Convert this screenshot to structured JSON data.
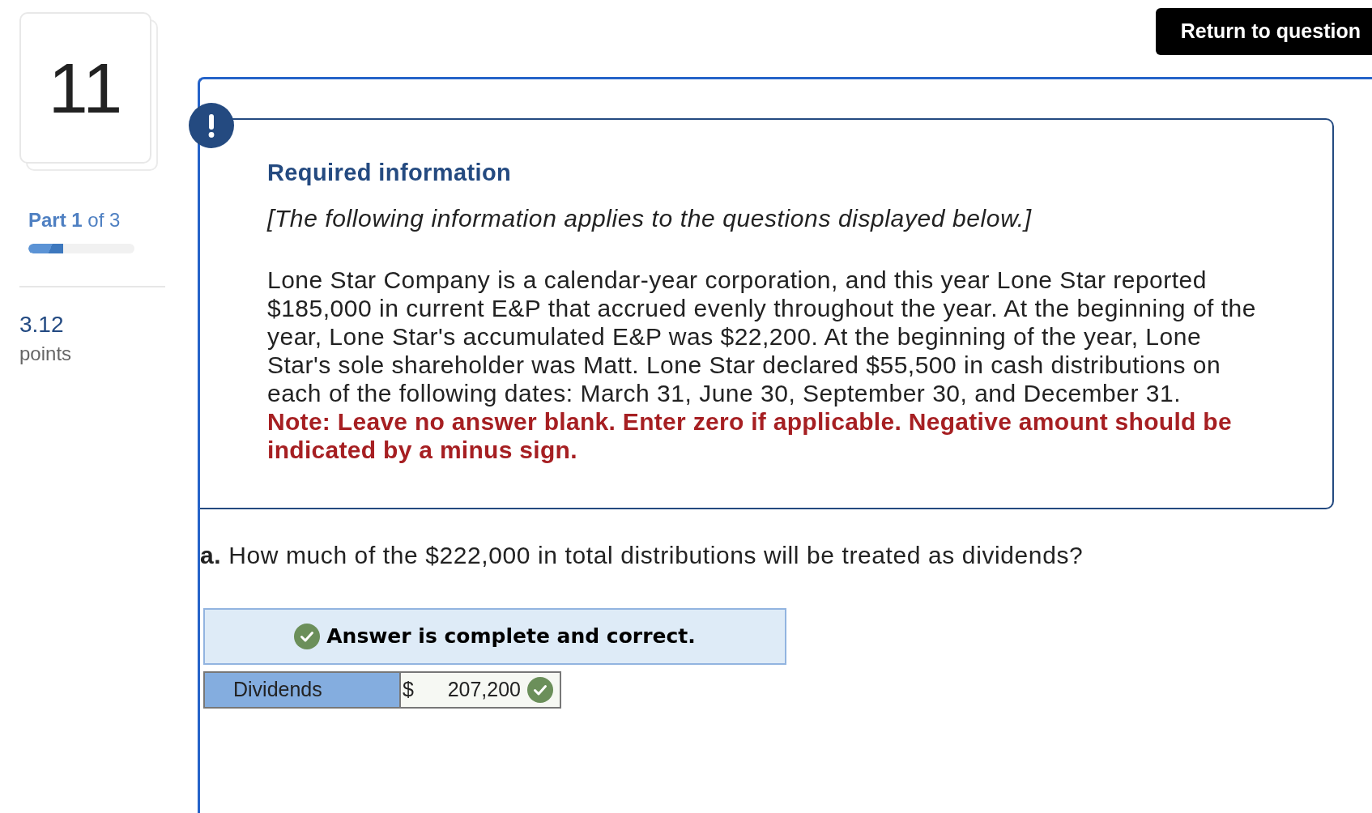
{
  "sidebar": {
    "question_number": "11",
    "part_label": "**Part 1** of 3",
    "progress": {
      "level": 0.33
    },
    "points": "3.12",
    "points_label": "points"
  },
  "header": {
    "return_button": "Return to question"
  },
  "required_info": {
    "title": "Required information",
    "intro": "[The following information applies to the questions displayed below.]",
    "body": "Lone Star Company is a calendar-year corporation, and this year Lone Star reported $185,000 in current E&P that accrued evenly throughout the year. At the beginning of the year, Lone Star's accumulated E&P was $22,200. At the beginning of the year, Lone Star's sole shareholder was Matt. Lone Star declared $55,500 in cash distributions on each of the following dates: March 31, June 30, September 30, and December 31.",
    "note": "Note: Leave no answer blank. Enter zero if applicable. Negative amount should be indicated by a minus sign."
  },
  "question": {
    "prompt": "**a.** How much of the $222,000 in total distributions will be treated as dividends?",
    "result": {
      "message": "Answer is complete and correct.",
      "correct": true
    },
    "rows": [
      {
        "label": "Dividends",
        "currency": "$",
        "value": "207,200",
        "correct": true
      }
    ]
  }
}
